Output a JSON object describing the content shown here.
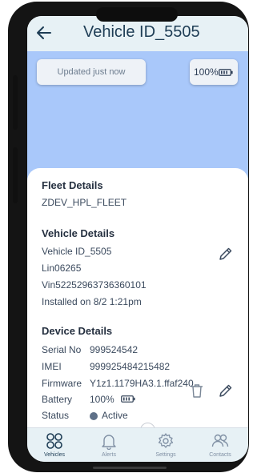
{
  "header": {
    "title": "Vehicle ID_5505",
    "back_icon": "arrow-left-icon"
  },
  "map": {
    "updated_text": "Updated just now",
    "battery_text": "100%"
  },
  "fleet": {
    "heading": "Fleet Details",
    "name": "ZDEV_HPL_FLEET"
  },
  "vehicle": {
    "heading": "Vehicle Details",
    "vehicle_id": "Vehicle ID_5505",
    "plate": "Lin06265",
    "vin": "Vin52252963736360101",
    "installed": "Installed on 8/2 1:21pm"
  },
  "device": {
    "heading": "Device Details",
    "serial_label": "Serial No",
    "serial_value": "999524542",
    "imei_label": "IMEI",
    "imei_value": "999925484215482",
    "firmware_label": "Firmware",
    "firmware_value": "Y1z1.1179HA3.1.ffaf240",
    "battery_label": "Battery",
    "battery_value": "100%",
    "status_label": "Status",
    "status_value": "Active"
  },
  "nav": [
    {
      "label": "Vehicles",
      "icon": "grid-circles-icon",
      "active": true
    },
    {
      "label": "Alerts",
      "icon": "bell-icon",
      "active": false
    },
    {
      "label": "Settings",
      "icon": "gear-icon",
      "active": false
    },
    {
      "label": "Contacts",
      "icon": "people-icon",
      "active": false
    }
  ],
  "colors": {
    "header_bg": "#e7f1f5",
    "map_bg": "#a9c8fa",
    "title_text": "#1e3d55",
    "nav_bg": "#e7f1f5"
  }
}
